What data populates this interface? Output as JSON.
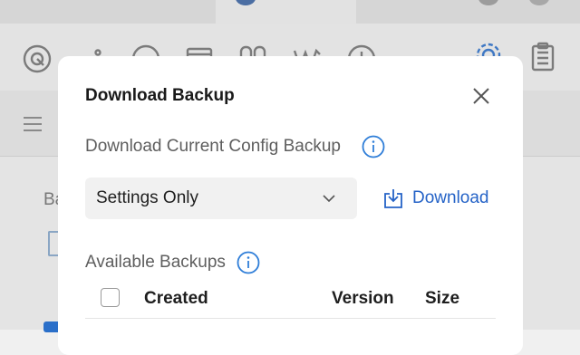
{
  "modal": {
    "title": "Download Backup",
    "close_icon": "close-icon",
    "current_config": {
      "label": "Download Current Config Backup",
      "info_icon": "info-icon",
      "select": {
        "value": "Settings Only",
        "chevron_icon": "chevron-down-icon"
      },
      "download": {
        "label": "Download",
        "icon": "download-icon"
      }
    },
    "available": {
      "label": "Available Backups",
      "info_icon": "info-icon",
      "columns": [
        "Created",
        "Version",
        "Size"
      ]
    }
  },
  "background": {
    "toolbar_icons": [
      "wifi-icon",
      "signal-icon",
      "gauge-icon",
      "monitor-icon",
      "users-icon",
      "chart-icon",
      "clock-icon",
      "gear-icon",
      "clipboard-icon"
    ],
    "partial_text": "Ba"
  },
  "colors": {
    "accent": "#2563c7",
    "info": "#2f7ed8",
    "overlay": "#e4e4e4",
    "modal_bg": "#ffffff"
  }
}
